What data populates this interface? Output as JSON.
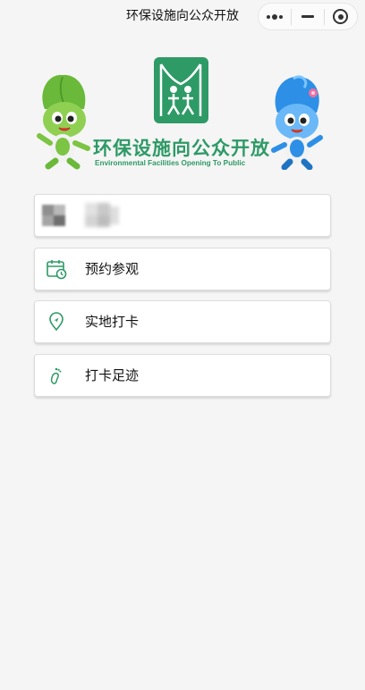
{
  "navbar": {
    "title": "环保设施向公众开放",
    "more_icon": "more-dots-icon",
    "minimize_icon": "minimize-icon",
    "close_icon": "target-close-icon"
  },
  "banner": {
    "title": "环保设施向公众开放",
    "subtitle": "Environmental Facilities Opening To Public",
    "brand_color": "#2e9a66"
  },
  "user": {
    "avatar_icon": "avatar-blurred",
    "name": ""
  },
  "menu": [
    {
      "label": "预约参观",
      "icon": "calendar-clock-icon"
    },
    {
      "label": "实地打卡",
      "icon": "location-pin-icon"
    },
    {
      "label": "打卡足迹",
      "icon": "footprint-icon"
    }
  ],
  "colors": {
    "accent": "#2e9a66",
    "background": "#f5f5f5"
  }
}
